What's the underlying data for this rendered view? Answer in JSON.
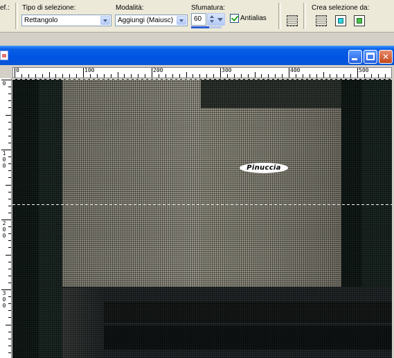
{
  "toolbar": {
    "cut_label": "ef.:",
    "selection_type": {
      "label": "Tipo di selezione:",
      "value": "Rettangolo"
    },
    "mode": {
      "label": "Modalità:",
      "value": "Aggiungi (Maiusc)"
    },
    "feather": {
      "label": "Sfumatura:",
      "value": "60",
      "slider_fraction": 0.6
    },
    "antialias": {
      "label": "Antialias",
      "checked": true
    },
    "create_selection": {
      "label": "Crea selezione da:",
      "icons": [
        "selection-from-layer-icon",
        "selection-from-mask-icon",
        "selection-from-all-layers-icon"
      ]
    },
    "extra_icon": "selection-grid-icon"
  },
  "window": {
    "icon": "image-document-icon",
    "buttons": {
      "minimize": "minimize-icon",
      "maximize": "maximize-icon",
      "close": "close-icon",
      "close_glyph": "✕"
    }
  },
  "rulers": {
    "top_labels": [
      "0",
      "100",
      "200",
      "300",
      "400",
      "500"
    ],
    "left_labels": [
      "0",
      "1\n0\n0",
      "2\n0\n0",
      "3\n0\n0"
    ]
  },
  "canvas": {
    "watermark_text": "Pinuccia",
    "colors": {
      "light_panel": "#8b8a7c",
      "dark_panel": "#1a2420",
      "edge_strip": "#0a110e",
      "title_blue": "#0054e3"
    }
  }
}
